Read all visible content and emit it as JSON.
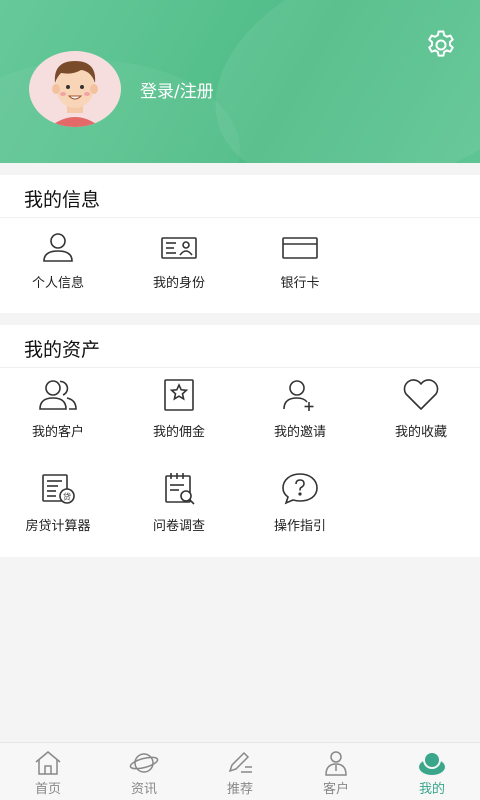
{
  "header": {
    "login_label": "登录/注册"
  },
  "info_section": {
    "title": "我的信息",
    "items": [
      {
        "label": "个人信息",
        "icon": "person-icon"
      },
      {
        "label": "我的身份",
        "icon": "id-card-icon"
      },
      {
        "label": "银行卡",
        "icon": "bank-card-icon"
      }
    ]
  },
  "asset_section": {
    "title": "我的资产",
    "items": [
      {
        "label": "我的客户",
        "icon": "customers-icon"
      },
      {
        "label": "我的佣金",
        "icon": "commission-icon"
      },
      {
        "label": "我的邀请",
        "icon": "add-user-icon"
      },
      {
        "label": "我的收藏",
        "icon": "heart-icon"
      },
      {
        "label": "房贷计算器",
        "icon": "calculator-icon"
      },
      {
        "label": "问卷调查",
        "icon": "survey-icon"
      },
      {
        "label": "操作指引",
        "icon": "help-icon"
      }
    ]
  },
  "tabbar": {
    "tabs": [
      {
        "label": "首页",
        "icon": "home-icon"
      },
      {
        "label": "资讯",
        "icon": "planet-icon"
      },
      {
        "label": "推荐",
        "icon": "pen-icon"
      },
      {
        "label": "客户",
        "icon": "customer-icon"
      },
      {
        "label": "我的",
        "icon": "profile-icon"
      }
    ],
    "active_index": 4
  },
  "colors": {
    "header_green": "#55c08c",
    "active_tab": "#3aa68a"
  }
}
